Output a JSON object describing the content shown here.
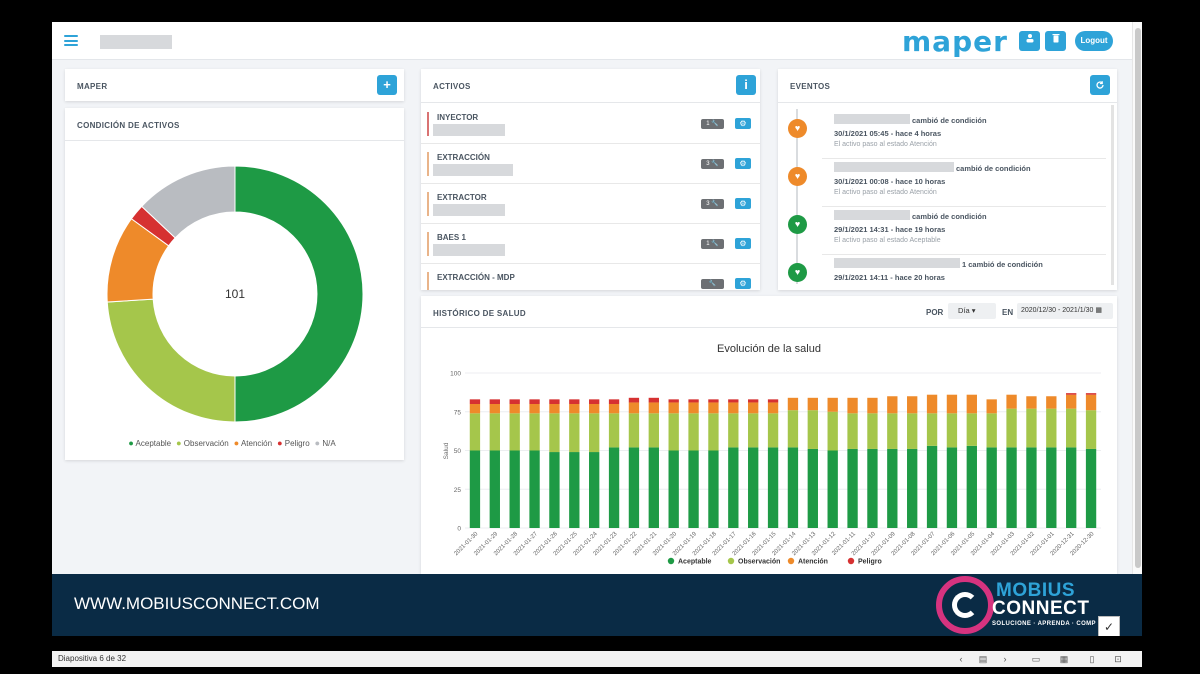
{
  "header": {
    "logo": "maper",
    "logout_label": "Logout",
    "user_icon": "user-icon",
    "trash_icon": "trash-icon"
  },
  "maper_panel": {
    "title": "MAPER",
    "add_label": "+"
  },
  "condicion": {
    "title": "CONDICIÓN DE ACTIVOS",
    "total": "101",
    "legend": [
      {
        "label": "Aceptable",
        "color": "#1e9a45"
      },
      {
        "label": "Observación",
        "color": "#a5c64b"
      },
      {
        "label": "Atención",
        "color": "#ee8a2a"
      },
      {
        "label": "Peligro",
        "color": "#d63131"
      },
      {
        "label": "N/A",
        "color": "#b9bcc1"
      }
    ]
  },
  "activos": {
    "title": "ACTIVOS",
    "info_label": "i",
    "items": [
      {
        "name": "INYECTOR",
        "badge": "1",
        "bar": "#d97373"
      },
      {
        "name": "EXTRACCIÓN",
        "badge": "3",
        "bar": "#e9b48a"
      },
      {
        "name": "EXTRACTOR",
        "badge": "3",
        "bar": "#e9b48a"
      },
      {
        "name": "BAES 1",
        "badge": "1",
        "bar": "#e9b48a"
      },
      {
        "name": "EXTRACCIÓN - MDP",
        "badge": "",
        "bar": "#e9b48a"
      }
    ]
  },
  "eventos": {
    "title": "EVENTOS",
    "items": [
      {
        "changed": "cambió de condición",
        "time": "30/1/2021 05:45 - hace 4 horas",
        "desc": "El activo paso al estado Atención",
        "color": "#ee8a2a"
      },
      {
        "changed": "cambió de condición",
        "time": "30/1/2021 00:08 - hace 10 horas",
        "desc": "El activo paso al estado Atención",
        "color": "#ee8a2a"
      },
      {
        "changed": "cambió de condición",
        "time": "29/1/2021 14:31 - hace 19 horas",
        "desc": "El activo paso al estado Aceptable",
        "color": "#1e9a45"
      },
      {
        "changed": "1 cambió de condición",
        "time": "29/1/2021 14:11 - hace 20 horas",
        "desc": "",
        "color": "#1e9a45"
      }
    ]
  },
  "historico": {
    "title": "HISTÓRICO DE SALUD",
    "por_label": "POR",
    "period_value": "Día",
    "en_label": "EN",
    "range_value": "2020/12/30 - 2021/1/30"
  },
  "chart_data": {
    "type": "bar",
    "title": "Evolución de la salud",
    "ylabel": "Salud",
    "xlabel": "",
    "ylim": [
      0,
      100
    ],
    "yticks": [
      0,
      25,
      50,
      75,
      100
    ],
    "categories": [
      "2021-01-30",
      "2021-01-29",
      "2021-01-28",
      "2021-01-27",
      "2021-01-26",
      "2021-01-25",
      "2021-01-24",
      "2021-01-23",
      "2021-01-22",
      "2021-01-21",
      "2021-01-20",
      "2021-01-19",
      "2021-01-18",
      "2021-01-17",
      "2021-01-16",
      "2021-01-15",
      "2021-01-14",
      "2021-01-13",
      "2021-01-12",
      "2021-01-11",
      "2021-01-10",
      "2021-01-09",
      "2021-01-08",
      "2021-01-07",
      "2021-01-06",
      "2021-01-05",
      "2021-01-04",
      "2021-01-03",
      "2021-01-02",
      "2021-01-01",
      "2020-12-31",
      "2020-12-30"
    ],
    "series": [
      {
        "name": "Aceptable",
        "color": "#1e9a45",
        "values": [
          50,
          50,
          50,
          50,
          49,
          49,
          49,
          52,
          52,
          52,
          50,
          50,
          50,
          52,
          52,
          52,
          52,
          51,
          50,
          51,
          51,
          51,
          51,
          53,
          52,
          53,
          52,
          52,
          52,
          52,
          52,
          51
        ]
      },
      {
        "name": "Observación",
        "color": "#a5c64b",
        "values": [
          24,
          24,
          24,
          24,
          25,
          25,
          25,
          22,
          22,
          22,
          24,
          24,
          24,
          22,
          22,
          22,
          24,
          25,
          25,
          23,
          23,
          23,
          23,
          21,
          22,
          21,
          22,
          25,
          25,
          25,
          25,
          25
        ]
      },
      {
        "name": "Atención",
        "color": "#ee8a2a",
        "values": [
          6,
          6,
          6,
          6,
          6,
          6,
          6,
          6,
          7,
          7,
          7,
          7,
          7,
          7,
          7,
          7,
          8,
          8,
          9,
          10,
          10,
          11,
          11,
          12,
          12,
          12,
          9,
          9,
          8,
          8,
          9,
          10
        ]
      },
      {
        "name": "Peligro",
        "color": "#d63131",
        "values": [
          3,
          3,
          3,
          3,
          3,
          3,
          3,
          3,
          3,
          3,
          2,
          2,
          2,
          2,
          2,
          2,
          0,
          0,
          0,
          0,
          0,
          0,
          0,
          0,
          0,
          0,
          0,
          0,
          0,
          0,
          1,
          1
        ]
      }
    ]
  },
  "band": {
    "url": "WWW.MOBIUSCONNECT.COM",
    "brand1": "MOBIUS",
    "brand2": "CONNECT",
    "tagline": "SOLUCIONE · APRENDA · COMP"
  },
  "statusbar": {
    "slide": "Diapositiva 6 de 32"
  }
}
